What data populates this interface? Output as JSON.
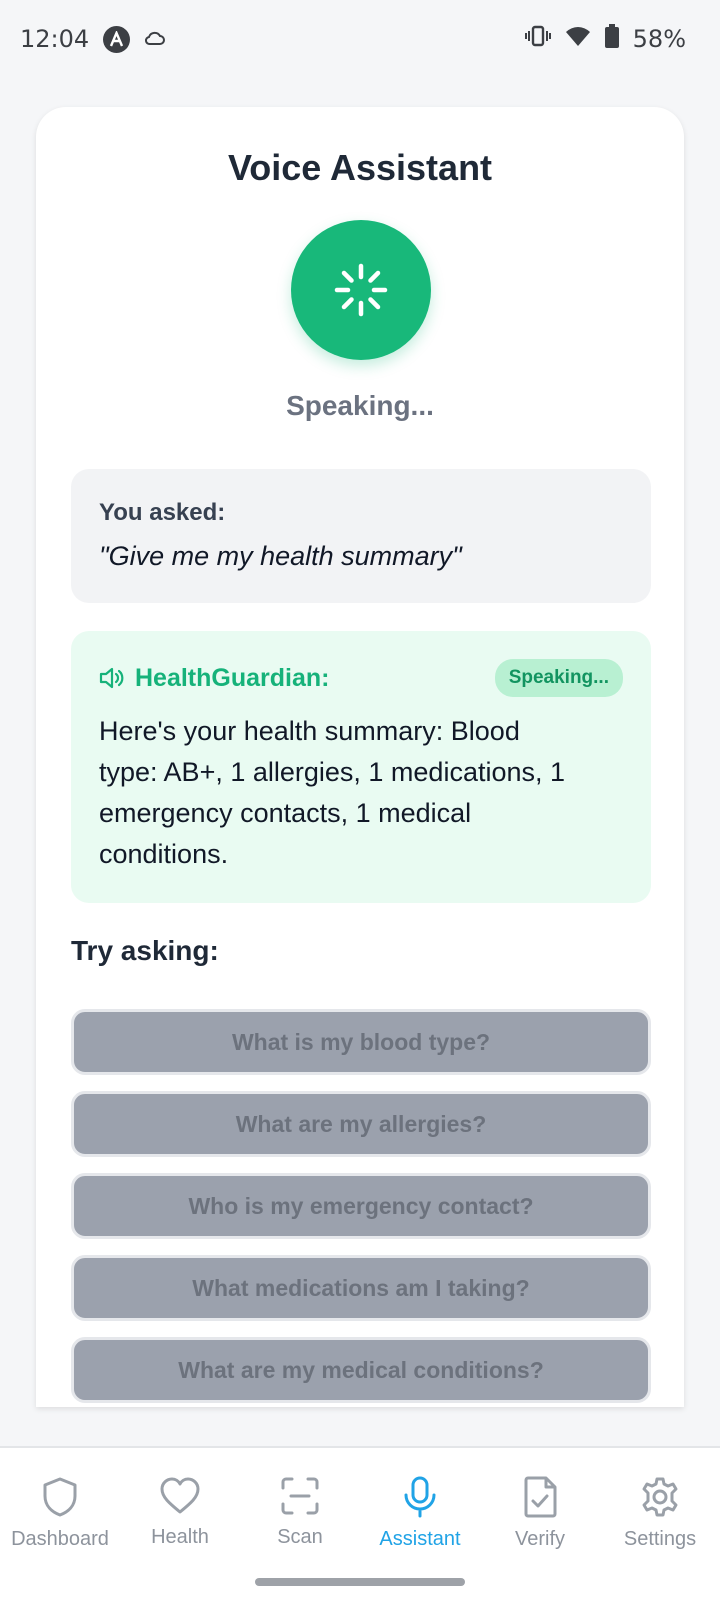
{
  "status_bar": {
    "time": "12:04",
    "battery": "58%",
    "icons": [
      "a-badge-icon",
      "cloud-icon",
      "vibrate-icon",
      "wifi-icon",
      "battery-icon"
    ]
  },
  "screen": {
    "title": "Voice Assistant",
    "state": "Speaking...",
    "accent_color": "#18b87a"
  },
  "asked": {
    "label": "You asked:",
    "text": "\"Give me my health summary\""
  },
  "reply": {
    "name": "HealthGuardian:",
    "badge": "Speaking...",
    "text": "Here's your health summary: Blood type: AB+, 1 allergies, 1 medications, 1 emergency contacts, 1 medical conditions."
  },
  "suggestions": {
    "label": "Try asking:",
    "items": [
      "What is my blood type?",
      "What are my allergies?",
      "Who is my emergency contact?",
      "What medications am I taking?",
      "What are my medical conditions?"
    ]
  },
  "nav": {
    "items": [
      {
        "label": "Dashboard",
        "icon": "shield-icon"
      },
      {
        "label": "Health",
        "icon": "heart-icon"
      },
      {
        "label": "Scan",
        "icon": "scan-icon"
      },
      {
        "label": "Assistant",
        "icon": "microphone-icon"
      },
      {
        "label": "Verify",
        "icon": "document-check-icon"
      },
      {
        "label": "Settings",
        "icon": "gear-icon"
      }
    ],
    "active_index": 3,
    "active_color": "#20a3e6"
  }
}
